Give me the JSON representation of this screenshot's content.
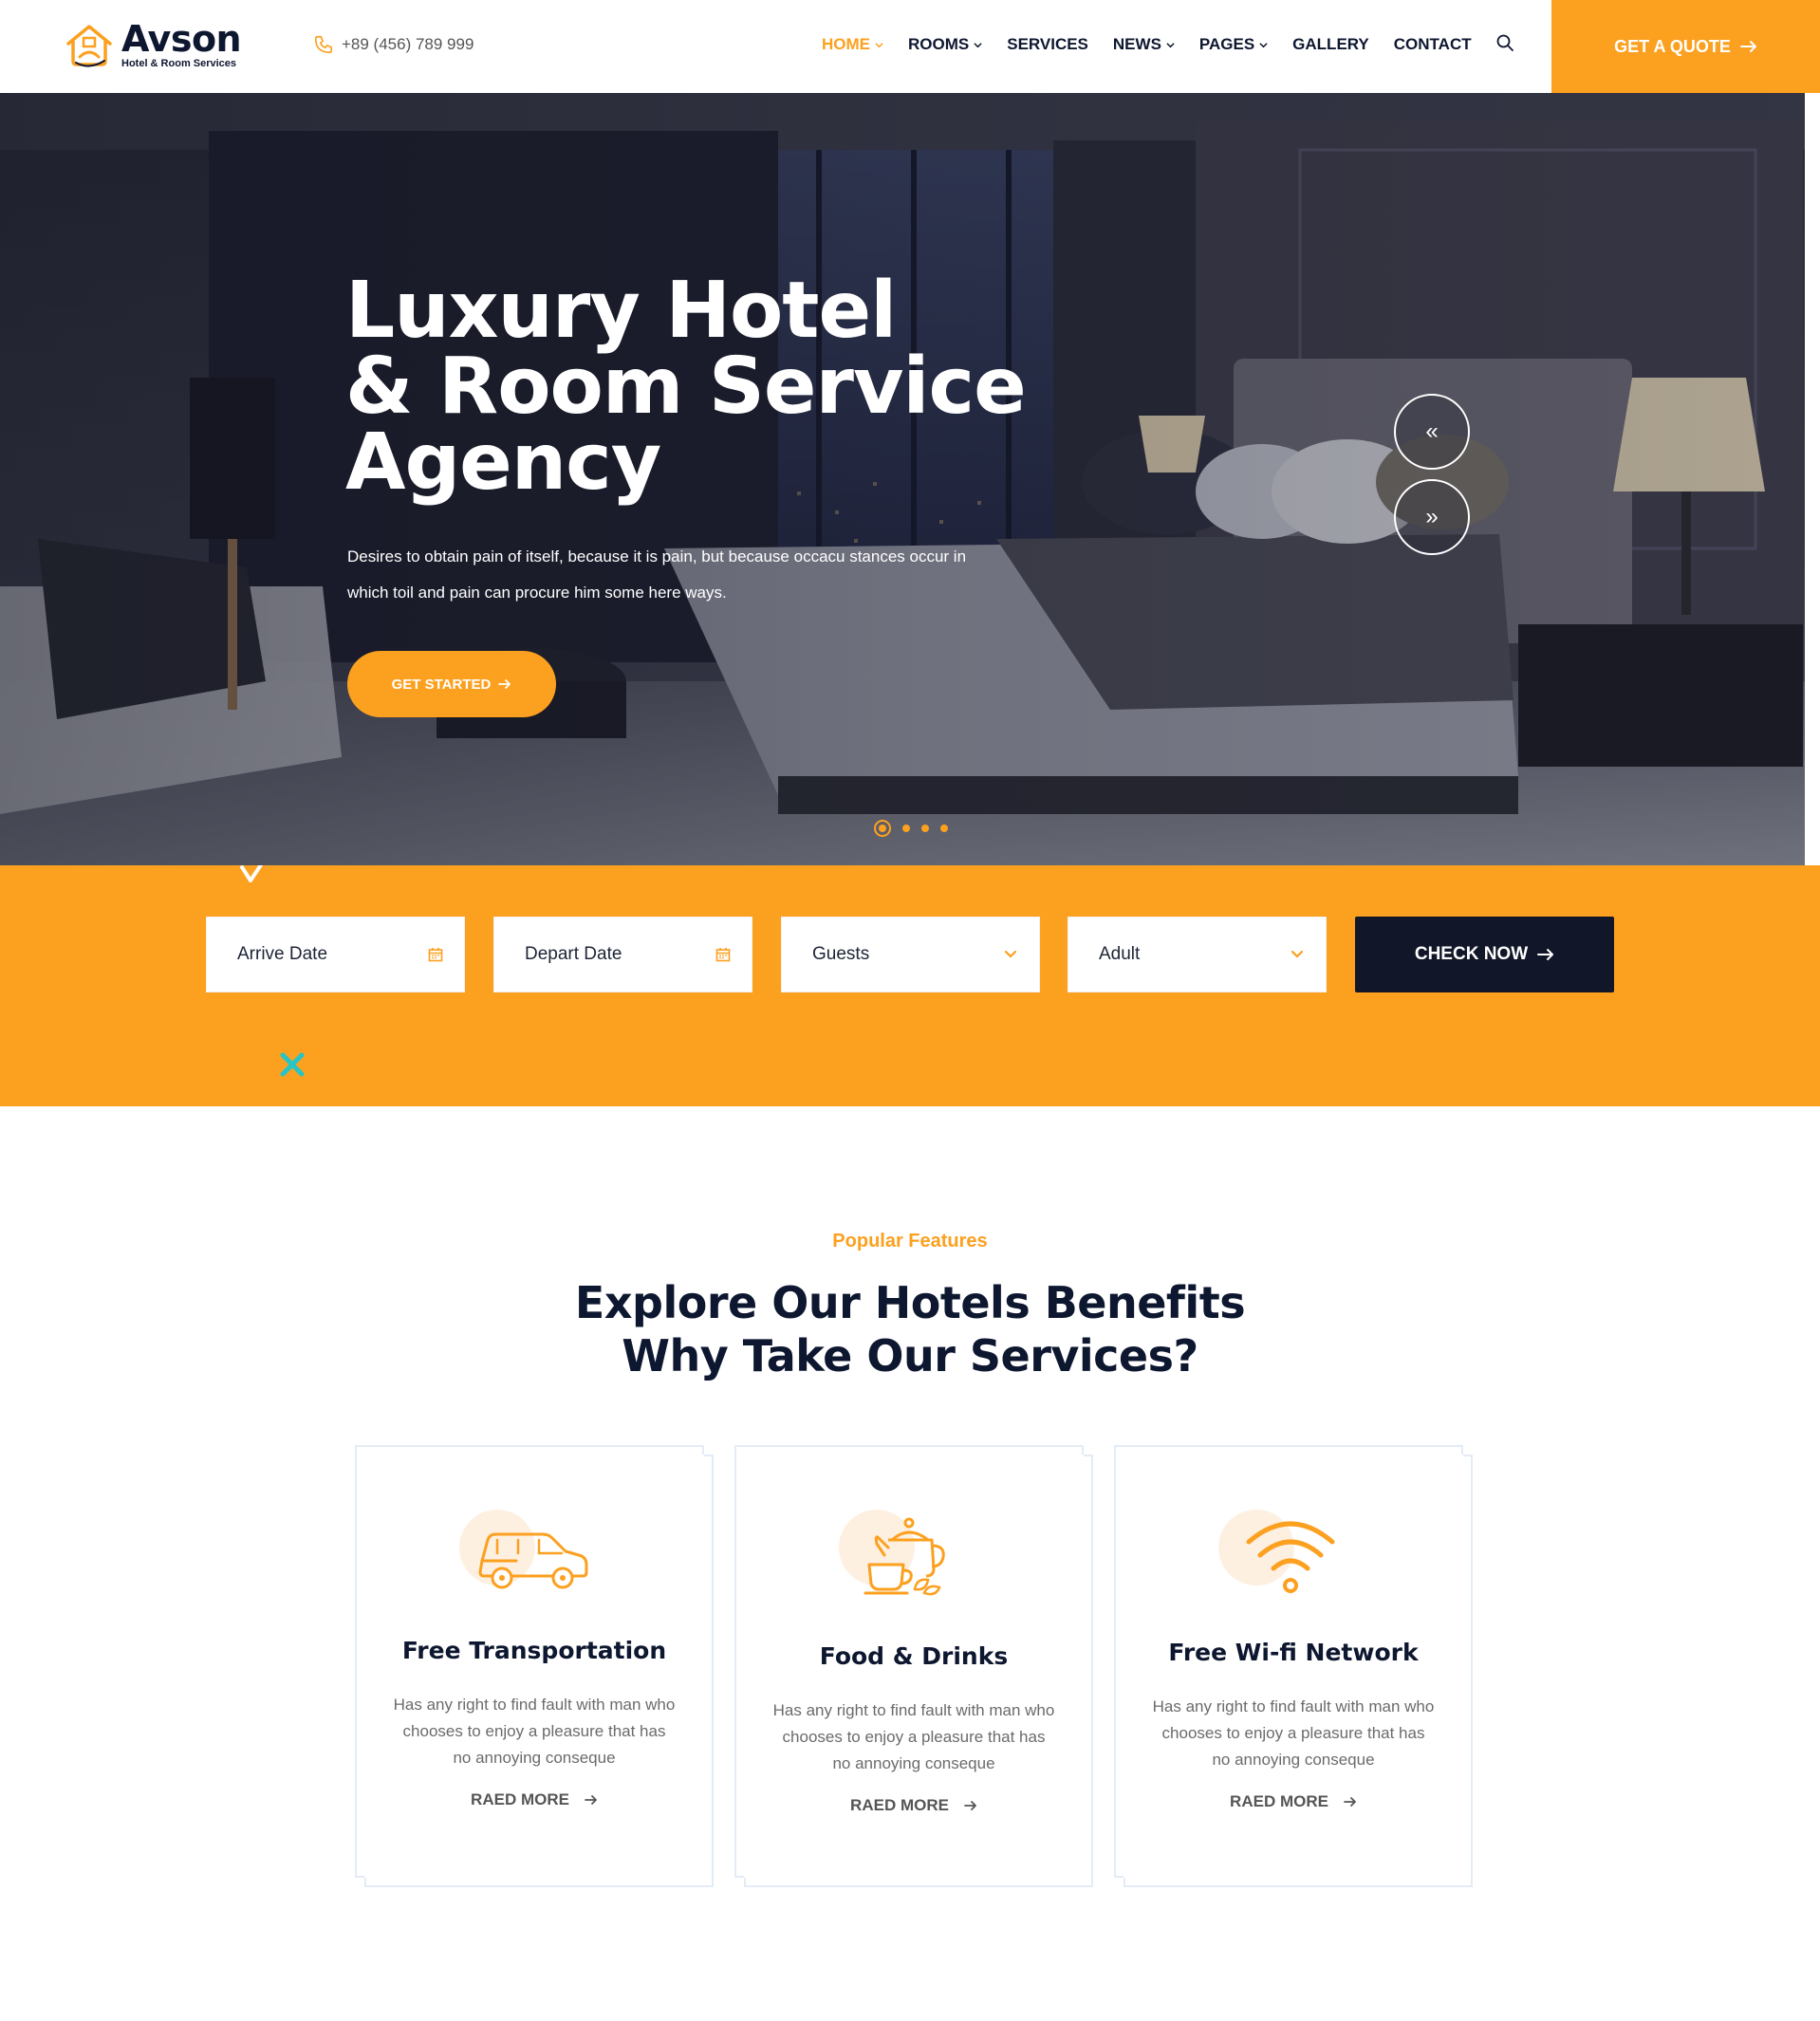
{
  "header": {
    "logo_name": "Avson",
    "logo_tagline": "Hotel & Room Services",
    "phone": "+89 (456) 789 999",
    "nav": [
      {
        "label": "HOME",
        "active": true,
        "has_dropdown": true
      },
      {
        "label": "ROOMS",
        "active": false,
        "has_dropdown": true
      },
      {
        "label": "SERVICES",
        "active": false,
        "has_dropdown": false
      },
      {
        "label": "NEWS",
        "active": false,
        "has_dropdown": true
      },
      {
        "label": "PAGES",
        "active": false,
        "has_dropdown": true
      },
      {
        "label": "GALLERY",
        "active": false,
        "has_dropdown": false
      },
      {
        "label": "CONTACT",
        "active": false,
        "has_dropdown": false
      }
    ],
    "quote_label": "GET A QUOTE"
  },
  "hero": {
    "title_line1": "Luxury Hotel",
    "title_line2": "& Room Service",
    "title_line3": "Agency",
    "desc_line1": "Desires to obtain pain of itself, because it is pain, but because occacu stances occur in",
    "desc_line2": "which toil and pain can procure him some here ways.",
    "cta_label": "GET STARTED",
    "prev_icon": "«",
    "next_icon": "»",
    "slide_count": 4,
    "active_slide": 1
  },
  "booking": {
    "arrive_label": "Arrive Date",
    "depart_label": "Depart Date",
    "guests_label": "Guests",
    "adult_label": "Adult",
    "check_label": "CHECK NOW"
  },
  "features": {
    "subtitle": "Popular Features",
    "title_line1": "Explore Our Hotels Benefits",
    "title_line2": "Why Take Our Services?",
    "cards": [
      {
        "title": "Free Transportation",
        "text": "Has any right to find fault with man who chooses to enjoy a pleasure that has no annoying conseque",
        "link": "RAED MORE",
        "icon": "car-icon"
      },
      {
        "title": "Food & Drinks",
        "text": "Has any right to find fault with man who chooses to enjoy a pleasure that has no annoying conseque",
        "link": "RAED MORE",
        "icon": "teapot-icon"
      },
      {
        "title": "Free Wi-fi Network",
        "text": "Has any right to find fault with man who chooses to enjoy a pleasure that has no annoying conseque",
        "link": "RAED MORE",
        "icon": "wifi-icon"
      }
    ]
  },
  "colors": {
    "accent": "#fca01f",
    "dark": "#0e1730",
    "button_dark": "#111728"
  }
}
